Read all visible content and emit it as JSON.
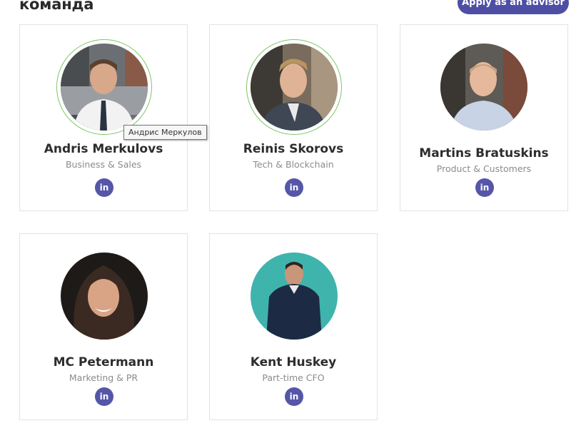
{
  "section": {
    "title": "команда"
  },
  "apply_button": {
    "label": "Apply as an advisor"
  },
  "tooltip": {
    "text": "Андрис Меркулов"
  },
  "team": [
    {
      "name": "Andris Merkulovs",
      "role": "Business & Sales",
      "linkedin_label": "in"
    },
    {
      "name": "Reinis Skorovs",
      "role": "Tech & Blockchain",
      "linkedin_label": "in"
    },
    {
      "name": "Martins Bratuskins",
      "role": "Product & Customers",
      "linkedin_label": "in"
    },
    {
      "name": "MC Petermann",
      "role": "Marketing & PR",
      "linkedin_label": "in"
    },
    {
      "name": "Kent Huskey",
      "role": "Part-time CFO",
      "linkedin_label": "in"
    }
  ],
  "colors": {
    "accent": "#4f4ea5",
    "linkedin_button": "#5556a8",
    "avatar_ring": "#7cc766",
    "card_border": "#e3e3e3"
  }
}
